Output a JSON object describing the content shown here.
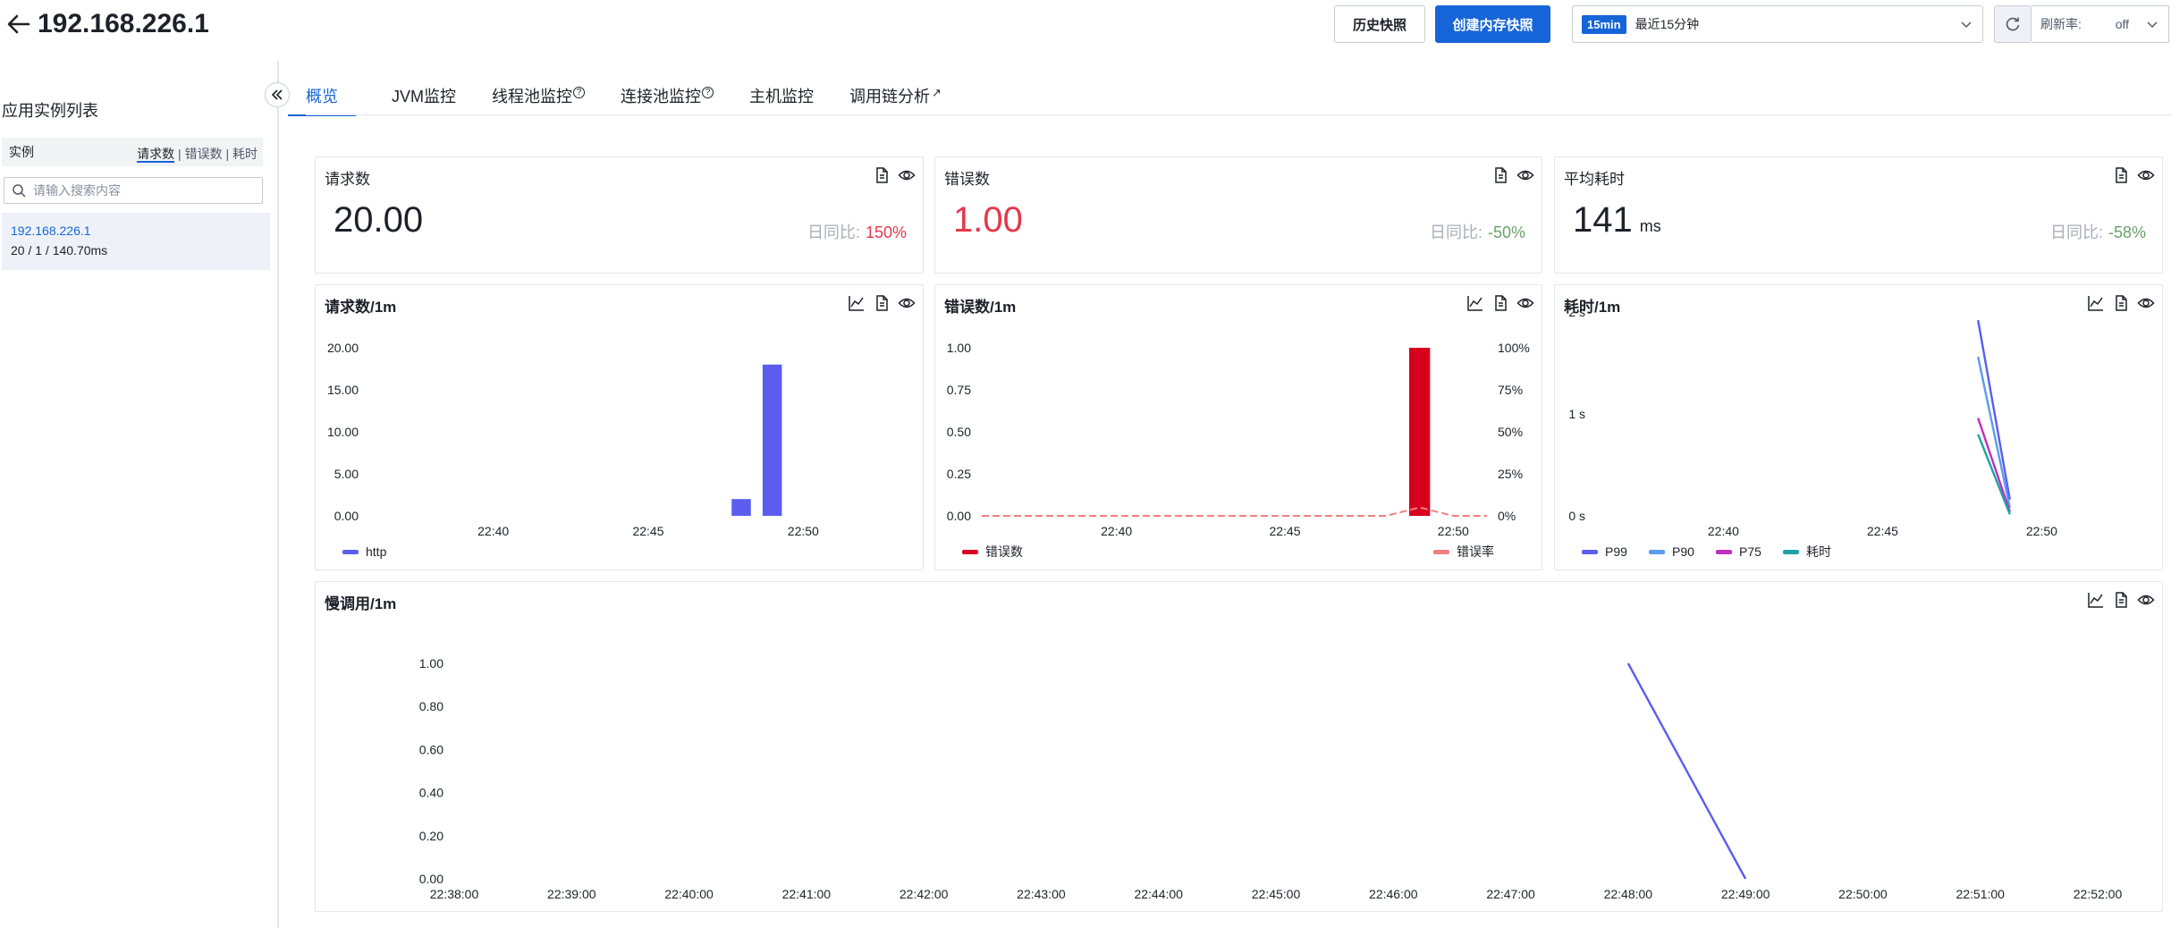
{
  "header": {
    "title": "192.168.226.1",
    "history_label": "历史快照",
    "create_label": "创建内存快照",
    "time_badge": "15min",
    "time_label": "最近15分钟",
    "refresh_label": "刷新率:",
    "refresh_value": "off"
  },
  "sidebar": {
    "title": "应用实例列表",
    "column_label": "实例",
    "sorts": [
      "请求数",
      "错误数",
      "耗时"
    ],
    "search_placeholder": "请输入搜索内容",
    "instances": [
      {
        "ip": "192.168.226.1",
        "stats": "20 / 1 / 140.70ms"
      }
    ]
  },
  "tabs": [
    {
      "label": "概览",
      "active": true,
      "icon": ""
    },
    {
      "label": "JVM监控",
      "active": false,
      "icon": ""
    },
    {
      "label": "线程池监控",
      "active": false,
      "icon": "help-icon"
    },
    {
      "label": "连接池监控",
      "active": false,
      "icon": "help-icon"
    },
    {
      "label": "主机监控",
      "active": false,
      "icon": ""
    },
    {
      "label": "调用链分析",
      "active": false,
      "icon": "external-link-icon"
    }
  ],
  "stats": {
    "requests": {
      "title": "请求数",
      "value": "20.00",
      "unit": "",
      "compare_label": "日同比:",
      "compare_value": "150%",
      "value_color": "#1d2129",
      "compare_color": "#e5374b"
    },
    "errors": {
      "title": "错误数",
      "value": "1.00",
      "unit": "",
      "compare_label": "日同比:",
      "compare_value": "-50%",
      "value_color": "#e5374b",
      "compare_color": "#6aa06a"
    },
    "latency": {
      "title": "平均耗时",
      "value": "141",
      "unit": "ms",
      "compare_label": "日同比:",
      "compare_value": "-58%",
      "value_color": "#1d2129",
      "compare_color": "#6aa06a"
    }
  },
  "chart_titles": {
    "requests": "请求数/1m",
    "errors": "错误数/1m",
    "latency": "耗时/1m",
    "slow": "慢调用/1m"
  },
  "chart_data": [
    {
      "id": "requests",
      "type": "bar",
      "x": [
        "22:48",
        "22:49"
      ],
      "series": [
        {
          "name": "http",
          "color": "#5b5cf0",
          "values": [
            2,
            18
          ]
        }
      ],
      "x_ticks": [
        "22:40",
        "22:45",
        "22:50"
      ],
      "y_ticks": [
        "0.00",
        "5.00",
        "10.00",
        "15.00",
        "20.00"
      ],
      "ylim": [
        0,
        20
      ],
      "xlim": [
        "22:36",
        "22:51"
      ],
      "legend": "bottom-left"
    },
    {
      "id": "errors",
      "type": "bar",
      "x": [
        "22:49"
      ],
      "series": [
        {
          "name": "错误数",
          "color": "#d6001c",
          "values": [
            1
          ]
        },
        {
          "name": "错误率",
          "color": "#f08080",
          "type": "line",
          "axis": "right",
          "x": [
            "22:36",
            "22:37",
            "22:38",
            "22:39",
            "22:40",
            "22:41",
            "22:42",
            "22:43",
            "22:44",
            "22:45",
            "22:46",
            "22:47",
            "22:48",
            "22:49",
            "22:50",
            "22:51"
          ],
          "values": [
            0,
            0,
            0,
            0,
            0,
            0,
            0,
            0,
            0,
            0,
            0,
            0,
            0,
            5,
            0,
            0
          ]
        }
      ],
      "x_ticks": [
        "22:40",
        "22:45",
        "22:50"
      ],
      "y_ticks": [
        "0.00",
        "0.25",
        "0.50",
        "0.75",
        "1.00"
      ],
      "y2_ticks": [
        "0%",
        "25%",
        "50%",
        "75%",
        "100%"
      ],
      "ylim": [
        0,
        1
      ],
      "y2lim": [
        0,
        100
      ],
      "xlim": [
        "22:36",
        "22:51"
      ],
      "legend": "bottom"
    },
    {
      "id": "latency",
      "type": "line",
      "x": [
        "22:48",
        "22:49"
      ],
      "series": [
        {
          "name": "P99",
          "color": "#5b5cf0",
          "values": [
            2.4,
            0.2
          ]
        },
        {
          "name": "P90",
          "color": "#5b9bf0",
          "values": [
            1.95,
            0.1
          ]
        },
        {
          "name": "P75",
          "color": "#c02fc0",
          "values": [
            1.2,
            0.05
          ]
        },
        {
          "name": "耗时",
          "color": "#1fa2a2",
          "values": [
            1.0,
            0.02
          ]
        }
      ],
      "x_ticks": [
        "22:40",
        "22:45",
        "22:50"
      ],
      "y_ticks": [
        "0 s",
        "1 s",
        "2 s"
      ],
      "ylim": [
        0,
        2.5
      ],
      "xlim": [
        "22:36",
        "22:51"
      ],
      "legend": "bottom-left"
    },
    {
      "id": "slow",
      "type": "line",
      "x": [
        "22:48",
        "22:49"
      ],
      "series": [
        {
          "color": "#5b5cf0",
          "values": [
            1,
            0
          ]
        }
      ],
      "x_ticks": [
        "22:38:00",
        "22:39:00",
        "22:40:00",
        "22:41:00",
        "22:42:00",
        "22:43:00",
        "22:44:00",
        "22:45:00",
        "22:46:00",
        "22:47:00",
        "22:48:00",
        "22:49:00",
        "22:50:00",
        "22:51:00",
        "22:52:00"
      ],
      "y_ticks": [
        "0.00",
        "0.20",
        "0.40",
        "0.60",
        "0.80",
        "1.00"
      ],
      "ylim": [
        0,
        1
      ],
      "xlim": [
        "22:38:00",
        "22:52:00"
      ]
    }
  ]
}
